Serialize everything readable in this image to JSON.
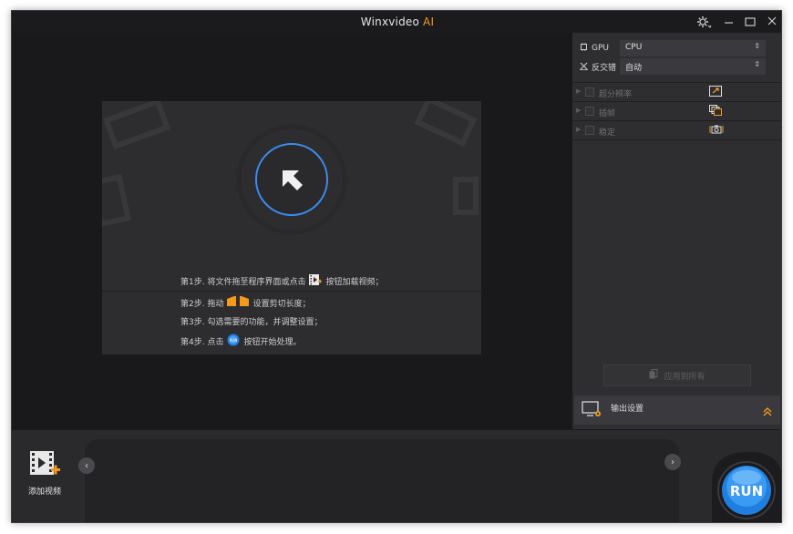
{
  "app": {
    "title": "Winxvideo",
    "title_suffix": "AI"
  },
  "steps": {
    "step1_pre": "第1步. 将文件拖至程序界面或点击",
    "step1_post": "按钮加载视频；",
    "step2_pre": "第2步. 拖动",
    "step2_post": "设置剪切长度；",
    "step3": "第3步. 勾选需要的功能，并调整设置；",
    "step4_pre": "第4步. 点击",
    "step4_post": "按钮开始处理。"
  },
  "hardware": {
    "gpu_label": "GPU",
    "gpu_value": "CPU",
    "deinterlace_label": "反交错",
    "deinterlace_value": "自动"
  },
  "features": [
    {
      "label": "超分辨率",
      "icon": "upscale-icon"
    },
    {
      "label": "插帧",
      "icon": "frame-interpolation-icon"
    },
    {
      "label": "稳定",
      "icon": "stabilize-camera-icon"
    }
  ],
  "apply_all_label": "应用到所有",
  "output_settings_label": "输出设置",
  "add_video_label": "添加视频",
  "run_label": "RUN",
  "colors": {
    "accent": "#f39a1e",
    "run_blue": "#1f7fe0",
    "ring_blue": "#3b8cf0"
  }
}
